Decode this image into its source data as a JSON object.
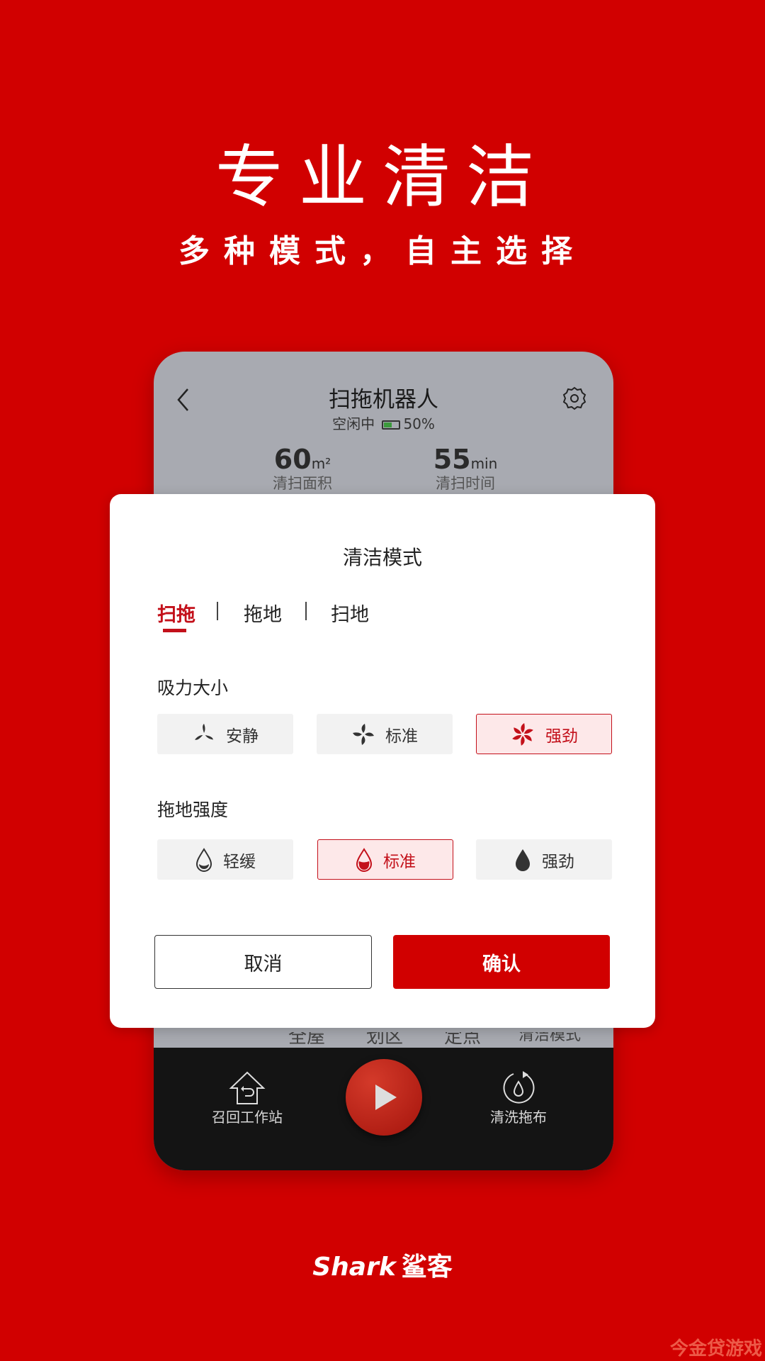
{
  "hero": {
    "title": "专业清洁",
    "subtitle": "多种模式，自主选择"
  },
  "device": {
    "title": "扫拖机器人",
    "status": "空闲中",
    "battery": "50%",
    "area_value": "60",
    "area_unit": "m²",
    "area_label": "清扫面积",
    "time_value": "55",
    "time_unit": "min",
    "time_label": "清扫时间"
  },
  "behind_tabs": [
    "全屋",
    "划区",
    "定点",
    "清洁模式"
  ],
  "dock": {
    "left_label": "召回工作站",
    "right_label": "清洗拖布"
  },
  "modal": {
    "title": "清洁模式",
    "tabs": [
      {
        "label": "扫拖",
        "active": true
      },
      {
        "label": "拖地",
        "active": false
      },
      {
        "label": "扫地",
        "active": false
      }
    ],
    "suction": {
      "label": "吸力大小",
      "options": [
        {
          "label": "安静",
          "selected": false
        },
        {
          "label": "标准",
          "selected": false
        },
        {
          "label": "强劲",
          "selected": true
        }
      ]
    },
    "mop": {
      "label": "拖地强度",
      "options": [
        {
          "label": "轻缓",
          "selected": false
        },
        {
          "label": "标准",
          "selected": true
        },
        {
          "label": "强劲",
          "selected": false
        }
      ]
    },
    "cancel": "取消",
    "confirm": "确认"
  },
  "brand": {
    "logo": "Shark",
    "logo_cn": "鲨客"
  },
  "watermark": "今金贷游戏",
  "colors": {
    "background": "#d10000",
    "accent": "#c3101a",
    "selected_bg": "#fde8e9"
  }
}
